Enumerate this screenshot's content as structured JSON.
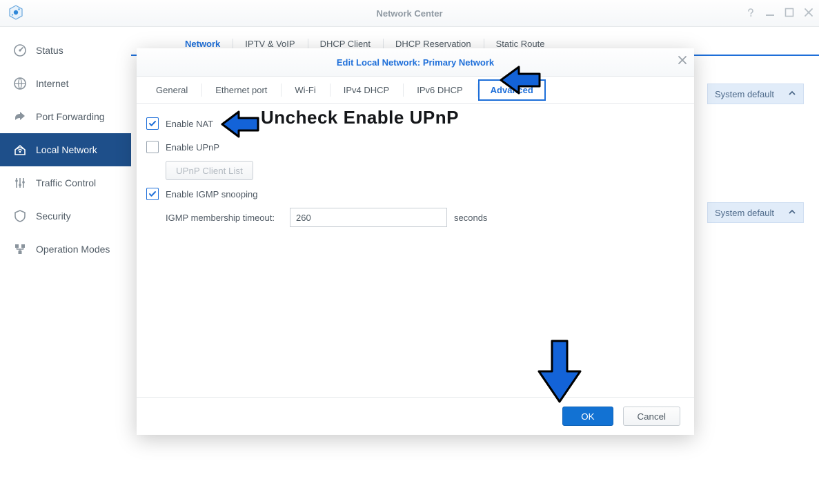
{
  "window": {
    "title": "Network Center"
  },
  "sidebar": {
    "items": [
      {
        "label": "Status"
      },
      {
        "label": "Internet"
      },
      {
        "label": "Port Forwarding"
      },
      {
        "label": "Local Network"
      },
      {
        "label": "Traffic Control"
      },
      {
        "label": "Security"
      },
      {
        "label": "Operation Modes"
      }
    ],
    "active_index": 3
  },
  "main_tabs": {
    "items": [
      {
        "label": "Network"
      },
      {
        "label": "IPTV & VoIP"
      },
      {
        "label": "DHCP Client"
      },
      {
        "label": "DHCP Reservation"
      },
      {
        "label": "Static Route"
      }
    ],
    "active_index": 0
  },
  "page_chips": [
    {
      "label": "System default"
    },
    {
      "label": "System default"
    }
  ],
  "dialog": {
    "title": "Edit Local Network: Primary Network",
    "tabs": [
      {
        "label": "General"
      },
      {
        "label": "Ethernet port"
      },
      {
        "label": "Wi-Fi"
      },
      {
        "label": "IPv4 DHCP"
      },
      {
        "label": "IPv6 DHCP"
      },
      {
        "label": "Advanced"
      }
    ],
    "active_tab_index": 5,
    "enable_nat": {
      "label": "Enable NAT",
      "checked": true
    },
    "enable_upnp": {
      "label": "Enable UPnP",
      "checked": false
    },
    "upnp_client_list_label": "UPnP Client List",
    "enable_igmp": {
      "label": "Enable IGMP snooping",
      "checked": true
    },
    "igmp_timeout_label": "IGMP membership timeout:",
    "igmp_timeout_value": "260",
    "igmp_timeout_unit": "seconds",
    "ok_label": "OK",
    "cancel_label": "Cancel"
  },
  "annotation": {
    "text": "Uncheck Enable UPnP"
  }
}
